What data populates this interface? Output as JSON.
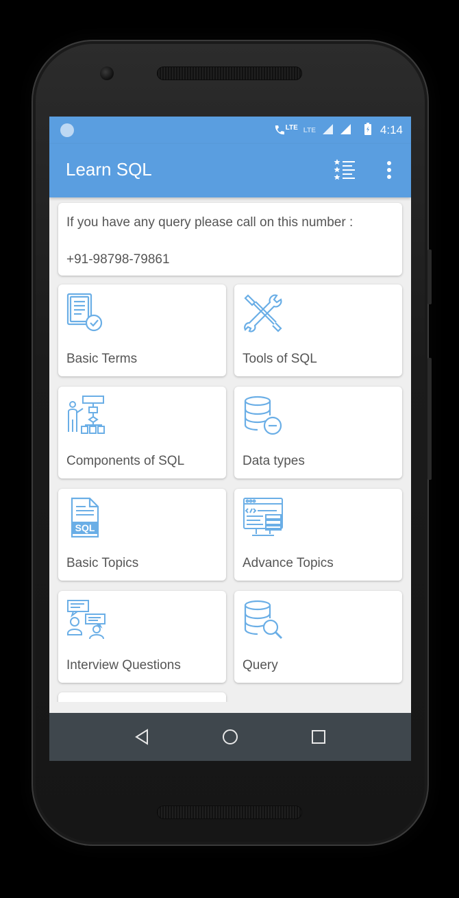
{
  "status_bar": {
    "network": "LTE",
    "network2": "LTE",
    "time": "4:14"
  },
  "app_bar": {
    "title": "Learn SQL"
  },
  "info": {
    "line1": "If you have any query please call on this number :",
    "phone": "+91-98798-79861"
  },
  "menu": [
    {
      "label": "Basic Terms",
      "icon": "document-check-icon"
    },
    {
      "label": "Tools of SQL",
      "icon": "tools-icon"
    },
    {
      "label": "Components of SQL",
      "icon": "presentation-diagram-icon"
    },
    {
      "label": "Data types",
      "icon": "database-minus-icon"
    },
    {
      "label": "Basic Topics",
      "icon": "sql-file-icon"
    },
    {
      "label": "Advance Topics",
      "icon": "code-window-icon"
    },
    {
      "label": "Interview Questions",
      "icon": "interview-chat-icon"
    },
    {
      "label": "Query",
      "icon": "database-search-icon"
    }
  ],
  "colors": {
    "primary": "#5a9ee0",
    "icon": "#6aaee6",
    "nav": "#3f474d"
  }
}
